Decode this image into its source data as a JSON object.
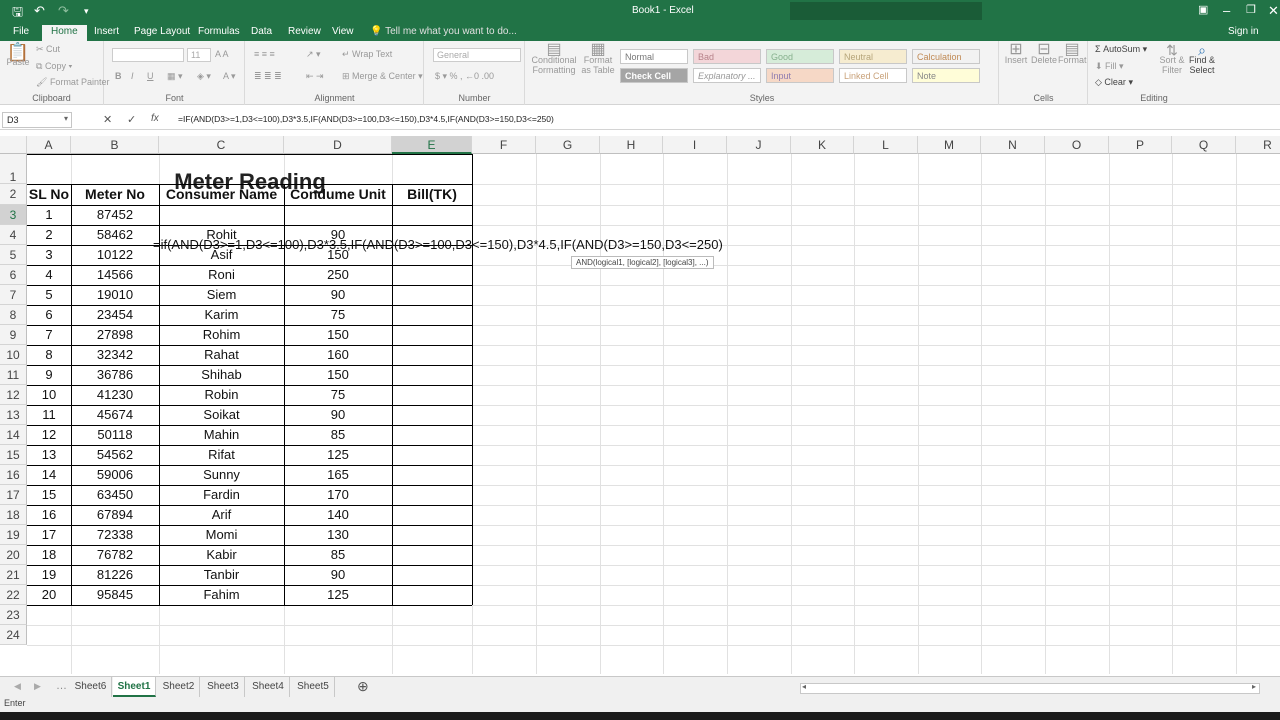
{
  "window": {
    "title": "Book1 - Excel",
    "colors": {
      "brand": "#217346"
    }
  },
  "ribbon_tabs": [
    "File",
    "Home",
    "Insert",
    "Page Layout",
    "Formulas",
    "Data",
    "Review",
    "View"
  ],
  "active_tab": "Home",
  "tell_me": "Tell me what you want to do...",
  "sign_in": "Sign in",
  "ribbon": {
    "clipboard": {
      "label": "Clipboard",
      "paste": "Paste",
      "cut": "Cut",
      "copy": "Copy",
      "format_painter": "Format Painter"
    },
    "font": {
      "label": "Font",
      "size": "11"
    },
    "alignment": {
      "label": "Alignment",
      "wrap": "Wrap Text",
      "merge": "Merge & Center"
    },
    "number": {
      "label": "Number",
      "format": "General"
    },
    "styles": {
      "label": "Styles",
      "conditional": "Conditional Formatting",
      "format_table": "Format as Table",
      "cells": [
        "Normal",
        "Bad",
        "Good",
        "Neutral",
        "Calculation",
        "Check Cell",
        "Explanatory ...",
        "Input",
        "Linked Cell",
        "Note"
      ]
    },
    "cells": {
      "label": "Cells",
      "insert": "Insert",
      "delete": "Delete",
      "format": "Format"
    },
    "editing": {
      "label": "Editing",
      "autosum": "AutoSum",
      "fill": "Fill",
      "clear": "Clear",
      "sort": "Sort & Filter",
      "find": "Find & Select"
    }
  },
  "formula_bar": {
    "name_box": "D3",
    "formula": "=IF(AND(D3>=1,D3<=100),D3*3.5,IF(AND(D3>=100,D3<=150),D3*4.5,IF(AND(D3>=150,D3<=250)"
  },
  "columns": [
    "A",
    "B",
    "C",
    "D",
    "E",
    "F",
    "G",
    "H",
    "I",
    "J",
    "K",
    "L",
    "M",
    "N",
    "O",
    "P",
    "Q",
    "R"
  ],
  "rows": [
    "1",
    "2",
    "3",
    "4",
    "5",
    "6",
    "7",
    "8",
    "9",
    "10",
    "11",
    "12",
    "13",
    "14",
    "15",
    "16",
    "17",
    "18",
    "19",
    "20",
    "21",
    "22",
    "23",
    "24"
  ],
  "sheet": {
    "title": "Meter Reading",
    "headers": [
      "SL No",
      "Meter No",
      "Consumer Name",
      "Condume Unit",
      "Bill(TK)"
    ],
    "data": [
      [
        "1",
        "87452",
        "",
        ""
      ],
      [
        "2",
        "58462",
        "Rohit",
        "90"
      ],
      [
        "3",
        "10122",
        "Asif",
        "150"
      ],
      [
        "4",
        "14566",
        "Roni",
        "250"
      ],
      [
        "5",
        "19010",
        "Siem",
        "90"
      ],
      [
        "6",
        "23454",
        "Karim",
        "75"
      ],
      [
        "7",
        "27898",
        "Rohim",
        "150"
      ],
      [
        "8",
        "32342",
        "Rahat",
        "160"
      ],
      [
        "9",
        "36786",
        "Shihab",
        "150"
      ],
      [
        "10",
        "41230",
        "Robin",
        "75"
      ],
      [
        "11",
        "45674",
        "Soikat",
        "90"
      ],
      [
        "12",
        "50118",
        "Mahin",
        "85"
      ],
      [
        "13",
        "54562",
        "Rifat",
        "125"
      ],
      [
        "14",
        "59006",
        "Sunny",
        "165"
      ],
      [
        "15",
        "63450",
        "Fardin",
        "170"
      ],
      [
        "16",
        "67894",
        "Arif",
        "140"
      ],
      [
        "17",
        "72338",
        "Momi",
        "130"
      ],
      [
        "18",
        "76782",
        "Kabir",
        "85"
      ],
      [
        "19",
        "81226",
        "Tanbir",
        "90"
      ],
      [
        "20",
        "95845",
        "Fahim",
        "125"
      ]
    ],
    "editing_formula": "=if(AND(D3>=1,D3<=100),D3*3.5,IF(AND(D3>=100,D3<=150),D3*4.5,IF(AND(D3>=150,D3<=250)",
    "tooltip": "AND(logical1, [logical2], [logical3], ...)"
  },
  "sheet_tabs": [
    "Sheet6",
    "Sheet1",
    "Sheet2",
    "Sheet3",
    "Sheet4",
    "Sheet5"
  ],
  "active_sheet": "Sheet1",
  "status": "Enter"
}
